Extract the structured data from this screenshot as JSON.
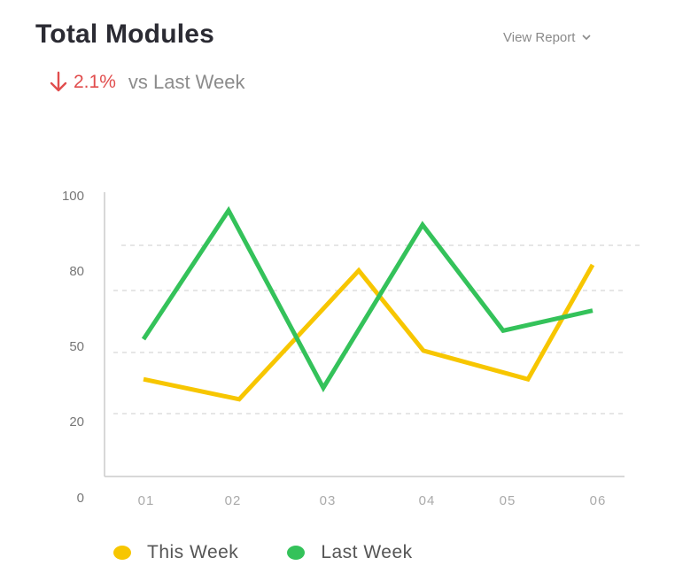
{
  "header": {
    "title": "Total Modules",
    "view_report_label": "View Report",
    "change_percent": "2.1%",
    "change_direction": "down",
    "comparison_label": "vs Last Week"
  },
  "colors": {
    "this_week": "#f7c600",
    "last_week": "#34c25a",
    "negative": "#e14d4d"
  },
  "chart_data": {
    "type": "line",
    "categories": [
      "01",
      "02",
      "03",
      "04",
      "05",
      "06"
    ],
    "y_ticks": [
      "100",
      "80",
      "50",
      "20",
      "0"
    ],
    "series": [
      {
        "name": "This Week",
        "values": [
          34,
          27,
          72,
          44,
          34,
          74
        ],
        "color": "#f7c600"
      },
      {
        "name": "Last Week",
        "values": [
          48,
          93,
          31,
          88,
          51,
          58
        ],
        "color": "#34c25a"
      }
    ],
    "grid": true,
    "legend_position": "bottom"
  }
}
